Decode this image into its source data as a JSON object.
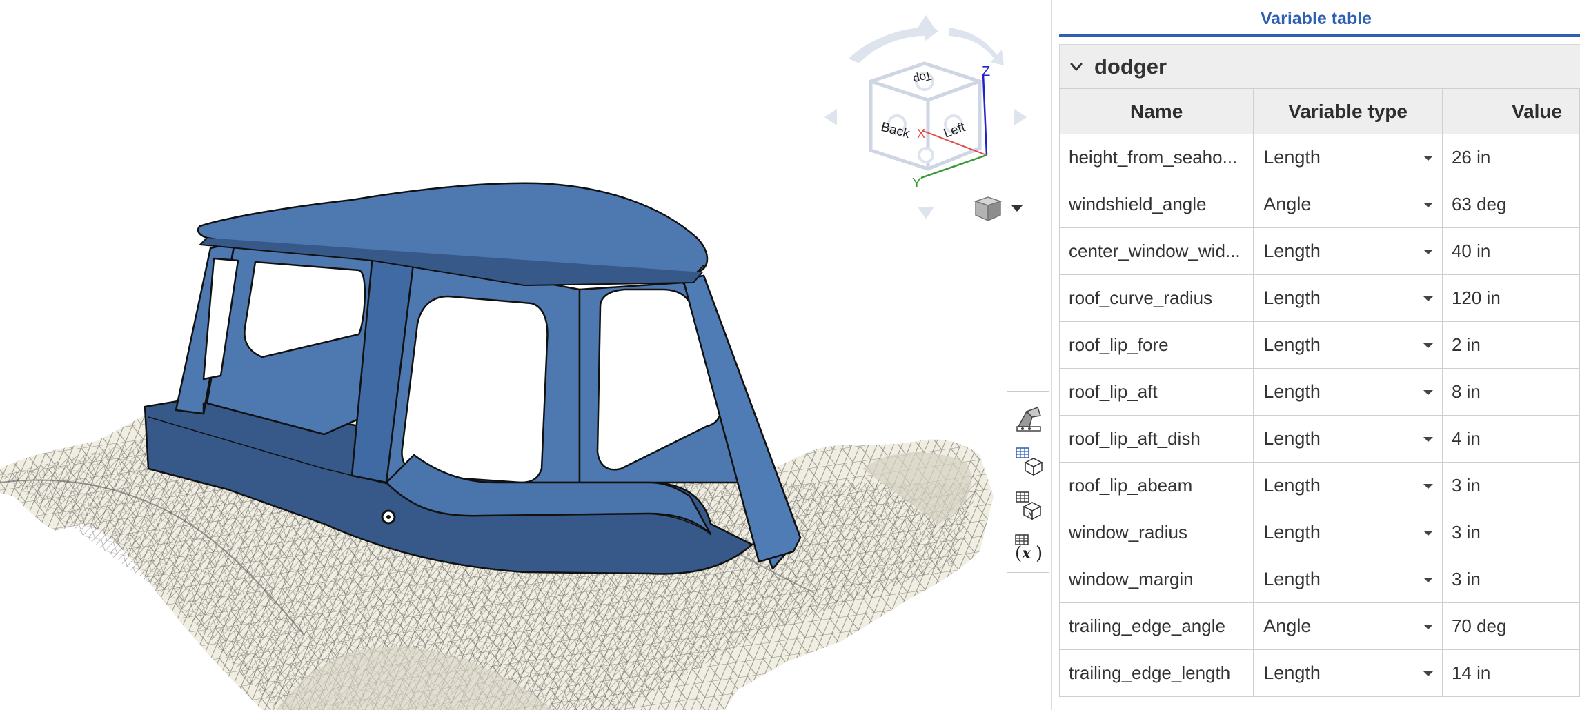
{
  "viewport": {
    "view_cube": {
      "faces": {
        "top": "Top",
        "back": "Back",
        "left": "Left"
      },
      "axes": {
        "x": "X",
        "y": "Y",
        "z": "Z"
      },
      "colors": {
        "x": "#e04848",
        "y": "#3a9a3a",
        "z": "#2222cc",
        "arrows": "#dde4ee"
      }
    },
    "model_colors": {
      "dodger": "#4d79b0",
      "dodger_dark": "#37598a",
      "mesh": "#f0ede1"
    },
    "icons": [
      "view-cube-icon",
      "display-mode-cube-icon",
      "chevron-down-icon"
    ]
  },
  "tool_strip": {
    "items": [
      {
        "name": "appearance-icon"
      },
      {
        "name": "configure-parts-icon"
      },
      {
        "name": "variable-studio-icon"
      },
      {
        "name": "variable-table-icon"
      }
    ]
  },
  "panel": {
    "title": "Variable table",
    "accent_color": "#2f5fb3",
    "group": {
      "name": "dodger",
      "icon": "chevron-down-icon"
    },
    "columns": [
      "Name",
      "Variable type",
      "Value"
    ],
    "rows": [
      {
        "name": "height_from_seaho...",
        "type": "Length",
        "value": "26 in"
      },
      {
        "name": "windshield_angle",
        "type": "Angle",
        "value": "63 deg"
      },
      {
        "name": "center_window_wid...",
        "type": "Length",
        "value": "40 in"
      },
      {
        "name": "roof_curve_radius",
        "type": "Length",
        "value": "120 in"
      },
      {
        "name": "roof_lip_fore",
        "type": "Length",
        "value": "2 in"
      },
      {
        "name": "roof_lip_aft",
        "type": "Length",
        "value": "8 in"
      },
      {
        "name": "roof_lip_aft_dish",
        "type": "Length",
        "value": "4 in"
      },
      {
        "name": "roof_lip_abeam",
        "type": "Length",
        "value": "3 in"
      },
      {
        "name": "window_radius",
        "type": "Length",
        "value": "3 in"
      },
      {
        "name": "window_margin",
        "type": "Length",
        "value": "3 in"
      },
      {
        "name": "trailing_edge_angle",
        "type": "Angle",
        "value": "70 deg"
      },
      {
        "name": "trailing_edge_length",
        "type": "Length",
        "value": "14 in"
      }
    ]
  }
}
